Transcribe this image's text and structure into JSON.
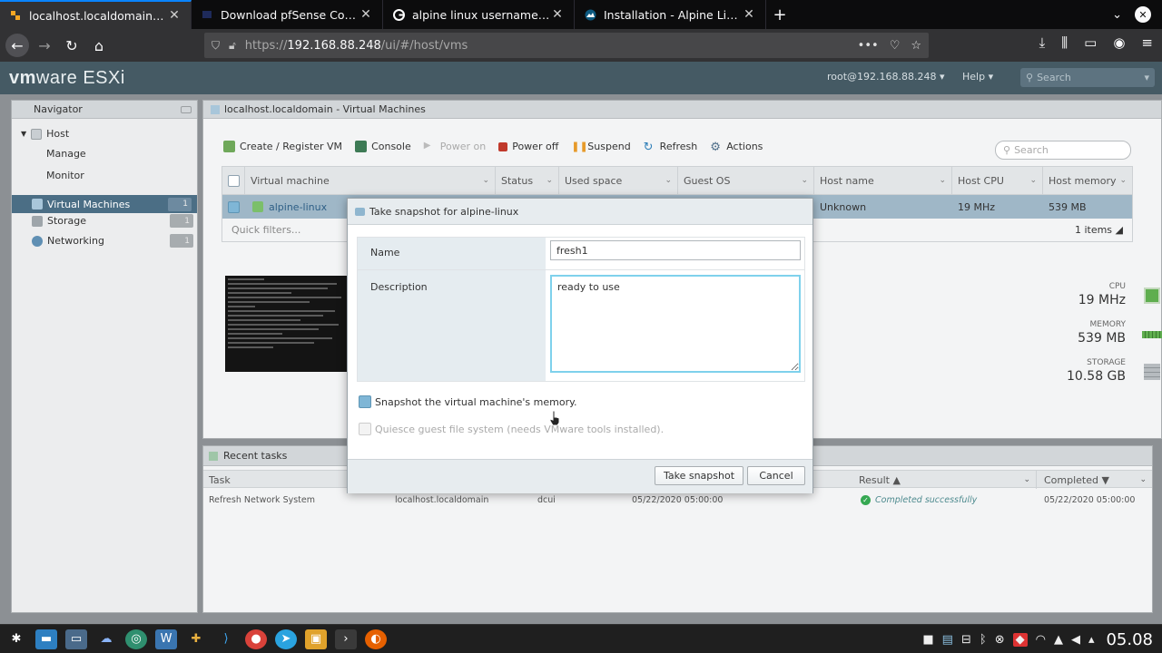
{
  "browser": {
    "tabs": [
      {
        "title": "localhost.localdomain - VMware ESXi",
        "favicon": "vmware-favicon",
        "active": true
      },
      {
        "title": "Download pfSense Community Edition",
        "favicon": "pfsense-favicon",
        "active": false
      },
      {
        "title": "alpine linux username password",
        "favicon": "google-favicon",
        "active": false
      },
      {
        "title": "Installation - Alpine Linux",
        "favicon": "alpine-favicon",
        "active": false
      }
    ],
    "url_prefix": "https://",
    "url_host": "192.168.88.248",
    "url_path": "/ui/#/host/vms"
  },
  "esxi": {
    "logo_brand": "vm",
    "logo_rest": "ware",
    "logo_product": "ESXi",
    "user": "root@192.168.88.248 ▾",
    "help": "Help ▾",
    "search_placeholder": "Search"
  },
  "navigator": {
    "title": "Navigator",
    "host": "Host",
    "manage": "Manage",
    "monitor": "Monitor",
    "items": [
      {
        "label": "Virtual Machines",
        "count": "1"
      },
      {
        "label": "Storage",
        "count": "1"
      },
      {
        "label": "Networking",
        "count": "1"
      }
    ]
  },
  "main": {
    "title": "localhost.localdomain - Virtual Machines",
    "toolbar": {
      "create": "Create / Register VM",
      "console": "Console",
      "power_on": "Power on",
      "power_off": "Power off",
      "suspend": "Suspend",
      "refresh": "Refresh",
      "actions": "Actions"
    },
    "search_placeholder": "Search",
    "columns": [
      "Virtual machine",
      "Status",
      "Used space",
      "Guest OS",
      "Host name",
      "Host CPU",
      "Host memory"
    ],
    "row": {
      "vm": "alpine-linux",
      "host_name": "Unknown",
      "host_cpu": "19 MHz",
      "host_memory": "539 MB"
    },
    "quick_filters": "Quick filters...",
    "items_count": "1 items ◢",
    "resources": {
      "cpu_label": "CPU",
      "cpu_value": "19 MHz",
      "memory_label": "MEMORY",
      "memory_value": "539 MB",
      "storage_label": "STORAGE",
      "storage_value": "10.58 GB"
    }
  },
  "tasks": {
    "title": "Recent tasks",
    "columns": [
      "Task",
      "Result ▲",
      "Completed ▼"
    ],
    "row": {
      "task": "Refresh Network System",
      "target": "localhost.localdomain",
      "initiator": "dcui",
      "queued": "05/22/2020 05:00:00",
      "result": "Completed successfully",
      "completed": "05/22/2020 05:00:00"
    }
  },
  "dialog": {
    "title": "Take snapshot for alpine-linux",
    "name_label": "Name",
    "name_value": "fresh1",
    "description_label": "Description",
    "description_value": "ready to use",
    "memory_checkbox": "Snapshot the virtual machine's memory.",
    "quiesce_checkbox": "Quiesce guest file system (needs VMware tools installed).",
    "take_snapshot_button": "Take snapshot",
    "cancel_button": "Cancel"
  },
  "taskbar": {
    "clock": "05.08"
  },
  "colors": {
    "esxi_header": "#455a64",
    "selection": "#9fb7c7",
    "nav_selected": "#4b6e85",
    "textarea_focus": "#7fd1ec",
    "firefox_accent": "#0a84ff"
  }
}
